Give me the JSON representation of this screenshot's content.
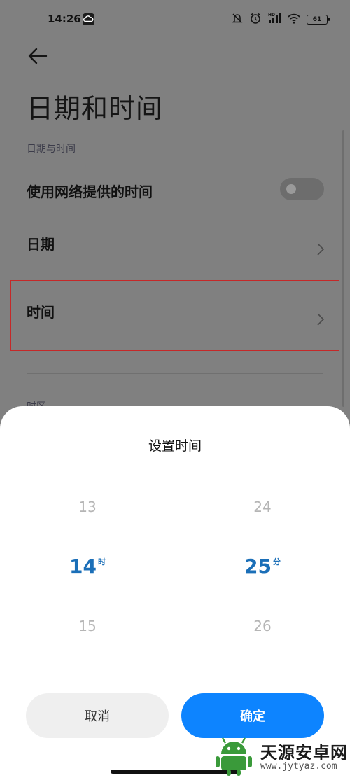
{
  "status_bar": {
    "time": "14:26",
    "battery": "61"
  },
  "header": {
    "title": "日期和时间",
    "back_icon": "arrow-left-icon"
  },
  "section": {
    "label": "日期与时间"
  },
  "rows": [
    {
      "label": "使用网络提供的时间",
      "control": "toggle",
      "toggle_on": false
    },
    {
      "label": "日期",
      "control": "chevron"
    },
    {
      "label": "时间",
      "control": "chevron"
    }
  ],
  "next_section_label": "时区",
  "dialog": {
    "title": "设置时间",
    "hour": {
      "prev": "13",
      "selected": "14",
      "next": "15",
      "unit": "时"
    },
    "minute": {
      "prev": "24",
      "selected": "25",
      "next": "26",
      "unit": "分"
    },
    "cancel_label": "取消",
    "confirm_label": "确定"
  },
  "watermark": {
    "name": "天源安卓网",
    "url": "www.jytyaz.com"
  },
  "colors": {
    "accent": "#0d84ff",
    "selected_value": "#1b6fb8",
    "highlight_border": "#c52828"
  }
}
